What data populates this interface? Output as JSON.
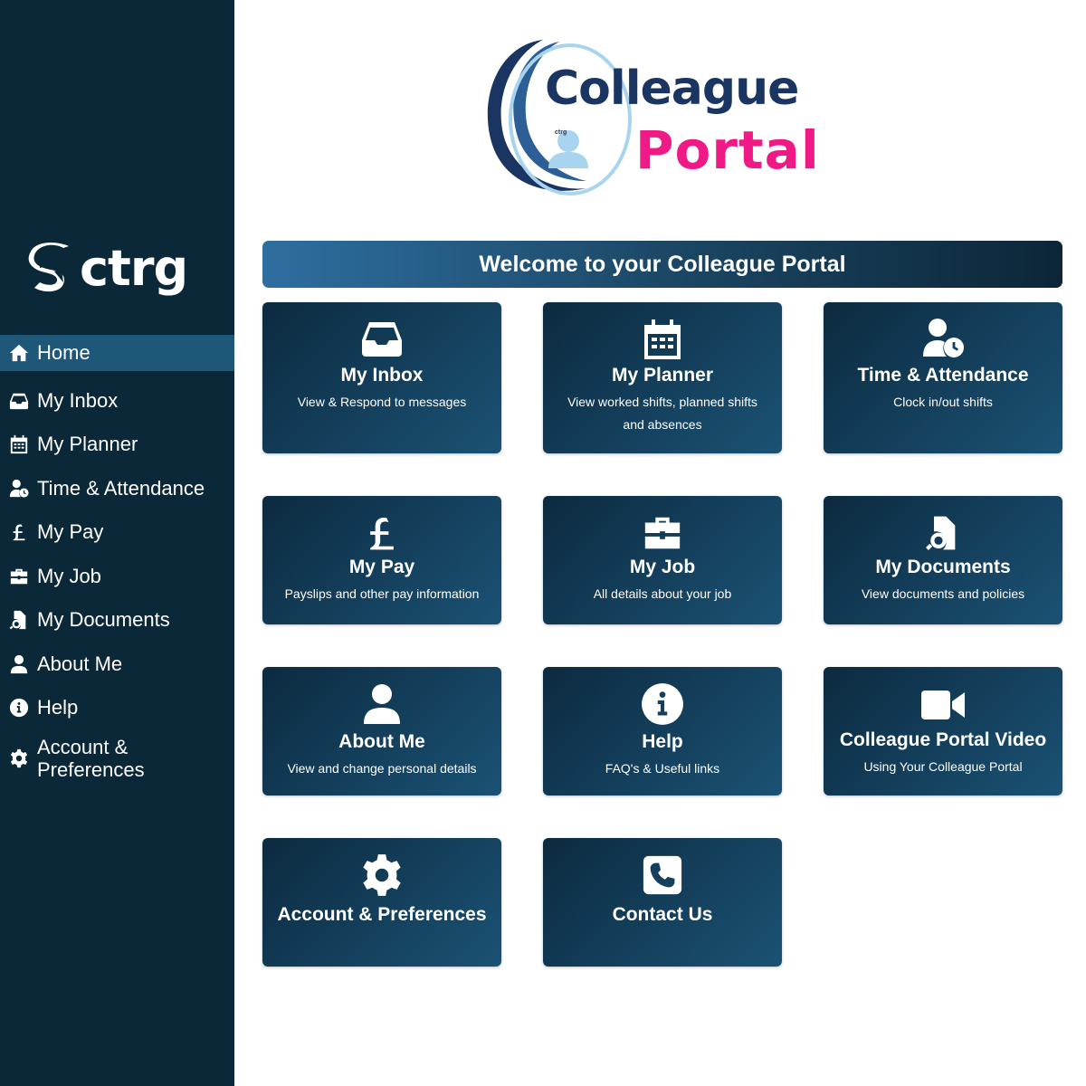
{
  "sidebar": {
    "brand": "ctrg",
    "items": [
      {
        "label": "Home",
        "icon": "home-icon",
        "active": true
      },
      {
        "label": "My Inbox",
        "icon": "inbox-icon"
      },
      {
        "label": "My Planner",
        "icon": "calendar-icon"
      },
      {
        "label": "Time & Attendance",
        "icon": "user-clock-icon"
      },
      {
        "label": "My Pay",
        "icon": "pound-icon"
      },
      {
        "label": "My Job",
        "icon": "briefcase-icon"
      },
      {
        "label": "My Documents",
        "icon": "document-search-icon"
      },
      {
        "label": "About Me",
        "icon": "user-icon"
      },
      {
        "label": "Help",
        "icon": "info-icon"
      },
      {
        "label": "Account &\nPreferences",
        "icon": "gear-icon"
      }
    ]
  },
  "logo": {
    "line1": "Colleague",
    "line2": "Portal",
    "badge": "ctrg"
  },
  "banner": {
    "title": "Welcome to your Colleague Portal"
  },
  "tiles": [
    {
      "title": "My Inbox",
      "subtitle": "View & Respond to messages",
      "icon": "inbox-icon"
    },
    {
      "title": "My Planner",
      "subtitle": "View worked shifts, planned shifts and absences",
      "icon": "calendar-icon"
    },
    {
      "title": "Time & Attendance",
      "subtitle": "Clock in/out shifts",
      "icon": "user-clock-icon"
    },
    {
      "title": "My Pay",
      "subtitle": "Payslips and other pay information",
      "icon": "pound-icon"
    },
    {
      "title": "My Job",
      "subtitle": "All details about your job",
      "icon": "briefcase-icon"
    },
    {
      "title": "My Documents",
      "subtitle": "View documents and policies",
      "icon": "document-search-icon"
    },
    {
      "title": "About Me",
      "subtitle": "View and change personal details",
      "icon": "user-icon"
    },
    {
      "title": "Help",
      "subtitle": "FAQ's & Useful links",
      "icon": "info-icon"
    },
    {
      "title": "Colleague Portal Video",
      "subtitle": "Using Your Colleague Portal",
      "icon": "video-icon"
    },
    {
      "title": "Account & Preferences",
      "subtitle": "",
      "icon": "gear-icon"
    },
    {
      "title": "Contact Us",
      "subtitle": "",
      "icon": "phone-icon"
    }
  ],
  "colors": {
    "sidebar_bg": "#0b2838",
    "active_item": "#1f5778",
    "logo_navy": "#1a3561",
    "logo_pink": "#f01a86"
  }
}
